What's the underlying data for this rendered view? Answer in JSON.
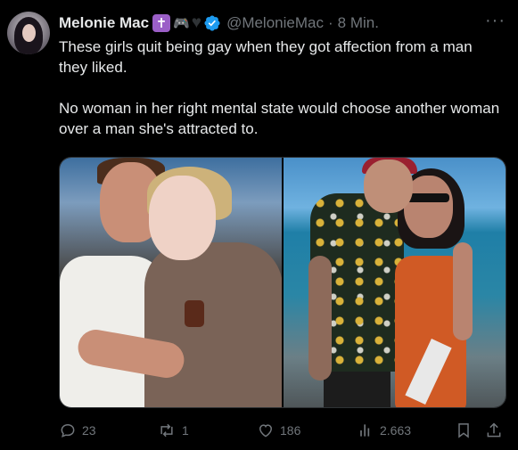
{
  "author": {
    "display_name": "Melonie Mac",
    "handle": "@MelonieMac",
    "time": "8 Min.",
    "badges": [
      "cross-emoji",
      "gamepad-emoji",
      "black-heart-emoji",
      "verified-badge"
    ]
  },
  "tweet": {
    "paragraphs": [
      "These girls quit being gay when they got affection from a man they liked.",
      "No woman in her right mental state would choose another woman over a man she's attracted to."
    ]
  },
  "media": {
    "count": 2
  },
  "actions": {
    "replies": "23",
    "reposts": "1",
    "likes": "186",
    "views": "2.663"
  },
  "colors": {
    "background": "#000000",
    "text": "#e7e9ea",
    "secondary": "#71767b",
    "verified": "#1d9bf0",
    "border": "#2f3336"
  }
}
